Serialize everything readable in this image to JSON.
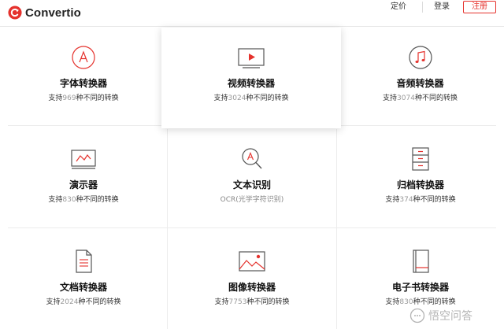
{
  "header": {
    "brand": "Convertio",
    "nav": {
      "pricing": "定价",
      "login": "登录",
      "register": "注册"
    }
  },
  "colors": {
    "accent": "#e5322d",
    "muted": "#999999"
  },
  "cards": [
    {
      "icon": "font-icon",
      "title": "字体转换器",
      "prefix": "支持",
      "count": "969",
      "suffix": "种不同的转换"
    },
    {
      "icon": "video-icon",
      "title": "视频转换器",
      "prefix": "支持",
      "count": "3024",
      "suffix": "种不同的转换"
    },
    {
      "icon": "music-note-icon",
      "title": "音频转换器",
      "prefix": "支持",
      "count": "3074",
      "suffix": "种不同的转换"
    },
    {
      "icon": "presentation-icon",
      "title": "演示器",
      "prefix": "支持",
      "count": "830",
      "suffix": "种不同的转换"
    },
    {
      "icon": "ocr-magnifier-icon",
      "title": "文本识别",
      "prefix": "",
      "count": "",
      "suffix": "OCR(光学字符识别)"
    },
    {
      "icon": "archive-icon",
      "title": "归档转换器",
      "prefix": "支持",
      "count": "374",
      "suffix": "种不同的转换"
    },
    {
      "icon": "document-icon",
      "title": "文档转换器",
      "prefix": "支持",
      "count": "2024",
      "suffix": "种不同的转换"
    },
    {
      "icon": "image-icon",
      "title": "图像转换器",
      "prefix": "支持",
      "count": "7753",
      "suffix": "种不同的转换"
    },
    {
      "icon": "ebook-icon",
      "title": "电子书转换器",
      "prefix": "支持",
      "count": "830",
      "suffix": "种不同的转换"
    }
  ],
  "watermark": {
    "icon": "chat-bubble-icon",
    "text": "悟空问答"
  }
}
